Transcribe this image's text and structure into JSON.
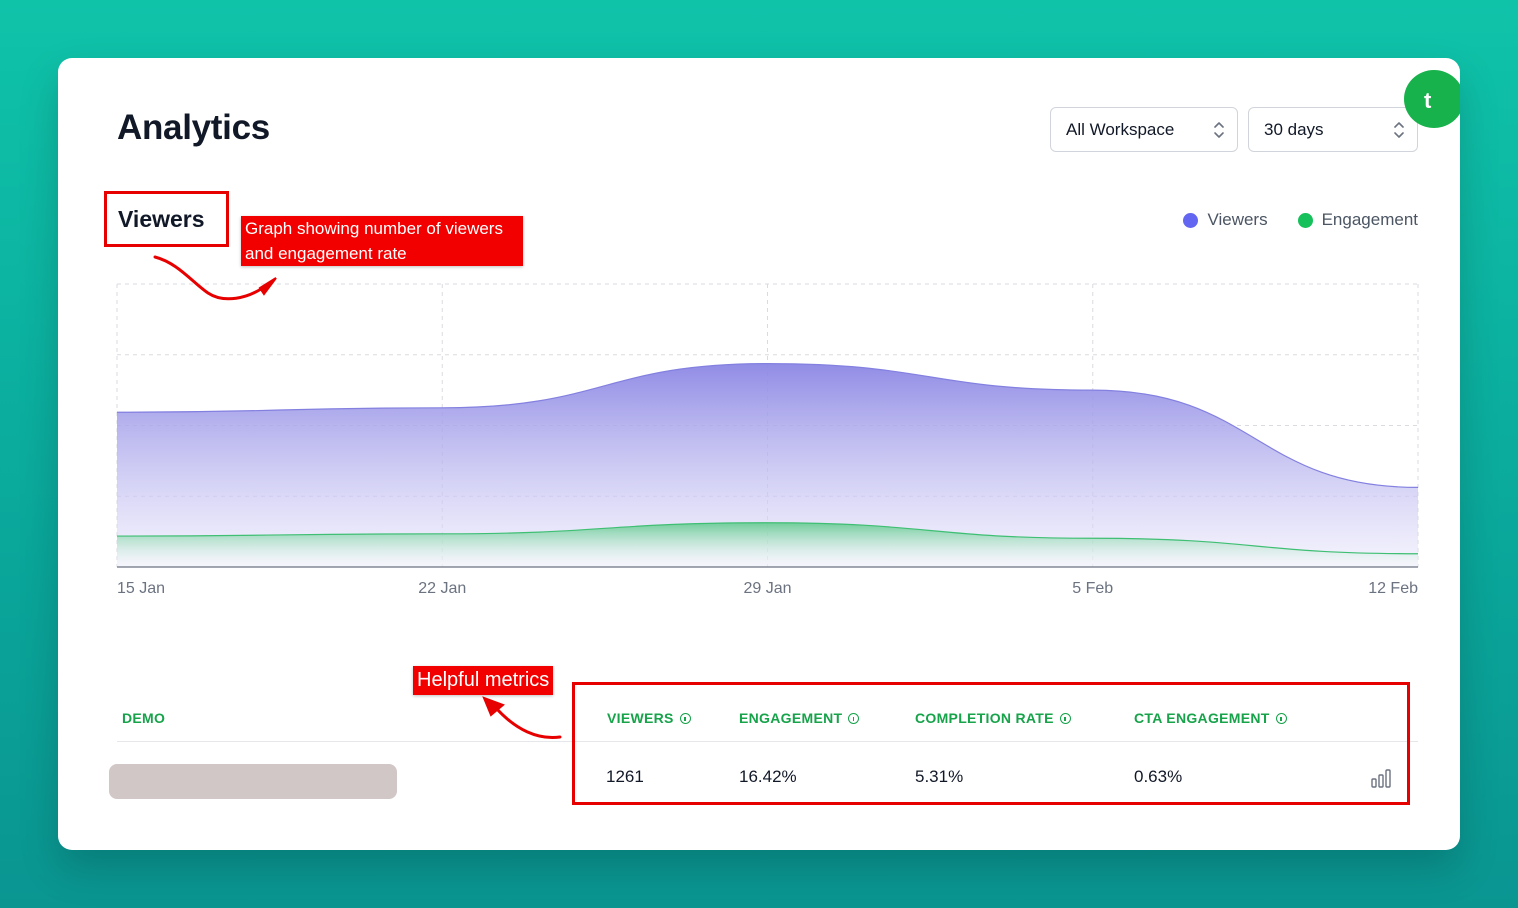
{
  "header": {
    "title": "Analytics",
    "workspace_select": "All Workspace",
    "range_select": "30 days",
    "corner_badge": "t"
  },
  "viewers_section": {
    "title": "Viewers",
    "annotation": "Graph showing number of viewers and engagement rate",
    "annotation_line1": "Graph showing number of viewers",
    "annotation_line2": "and engagement rate"
  },
  "chart_data": {
    "type": "area",
    "x": [
      "15 Jan",
      "22 Jan",
      "29 Jan",
      "5 Feb",
      "12 Feb"
    ],
    "series": [
      {
        "name": "Viewers",
        "color": "#6366f1",
        "values": [
          70,
          72,
          92,
          80,
          36
        ]
      },
      {
        "name": "Engagement",
        "color": "#16c05a",
        "values": [
          14,
          15,
          20,
          13,
          6
        ]
      }
    ],
    "ylim": [
      0,
      128
    ],
    "grid": true,
    "legend": "top-right"
  },
  "metrics": {
    "annotation": "Helpful metrics",
    "columns": {
      "demo": "DEMO",
      "viewers": "VIEWERS",
      "engagement": "ENGAGEMENT",
      "completion": "COMPLETION RATE",
      "cta": "CTA ENGAGEMENT"
    },
    "row": {
      "viewers": "1261",
      "engagement": "16.42%",
      "completion": "5.31%",
      "cta": "0.63%"
    }
  },
  "colors": {
    "annotation_red": "#e60000",
    "accent_green": "#16a34a",
    "viewers_purple": "#6366f1"
  },
  "icons": [
    "chevron-updown-icon",
    "info-icon",
    "bar-chart-icon",
    "annotation-arrow-icon"
  ]
}
